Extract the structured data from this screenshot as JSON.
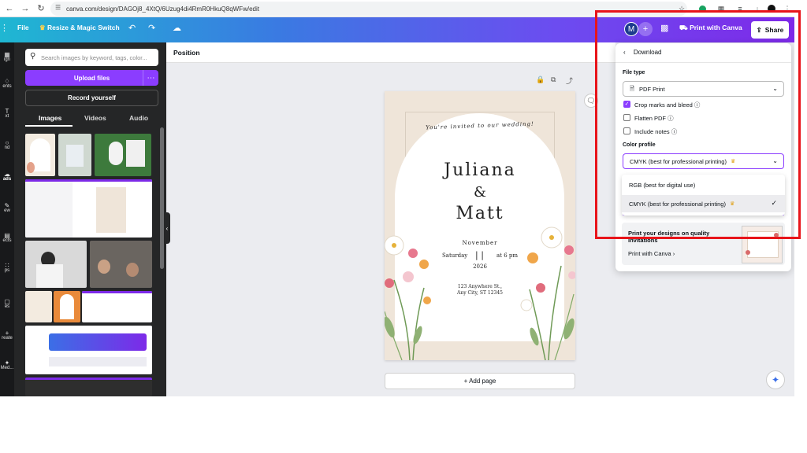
{
  "browser": {
    "url": "canva.com/design/DAGOj8_4XtQ/6Uzug4di4RmR0HkuQ8qWFw/edit"
  },
  "topbar": {
    "file_label": "File",
    "resize_label": "Resize & Magic Switch",
    "avatar_letter": "M",
    "print_label": "Print with Canva",
    "share_label": "Share"
  },
  "rail": {
    "items": [
      "ign",
      "ents",
      "xt",
      "nd",
      "ads",
      "ew",
      "ects",
      "ps",
      "es",
      "reate",
      "Med..."
    ]
  },
  "panel": {
    "search_placeholder": "Search images by keyword, tags, color...",
    "upload_label": "Upload files",
    "record_label": "Record yourself",
    "tabs": [
      "Images",
      "Videos",
      "Audio"
    ]
  },
  "editor": {
    "position_label": "Position",
    "add_page_label": "+ Add page"
  },
  "invitation": {
    "tagline": "You're invited to our wedding!",
    "name1": "Juliana",
    "amp": "&",
    "name2": "Matt",
    "month": "November",
    "day": "Saturday",
    "date_num": "| |",
    "time": "at 6 pm",
    "year": "2026",
    "address1": "123 Anywhere St.,",
    "address2": "Any City, ST 12345"
  },
  "download": {
    "title": "Download",
    "file_type_label": "File type",
    "file_type_value": "PDF Print",
    "options": [
      {
        "label": "Crop marks and bleed",
        "checked": true
      },
      {
        "label": "Flatten PDF",
        "checked": false
      },
      {
        "label": "Include notes",
        "checked": false
      }
    ],
    "color_profile_label": "Color profile",
    "color_profile_value": "CMYK (best for professional printing)",
    "list": [
      {
        "label": "RGB (best for digital use)",
        "selected": false
      },
      {
        "label": "CMYK (best for professional printing)",
        "selected": true
      }
    ],
    "promo_title": "Print your designs on quality invitations",
    "promo_link": "Print with Canva"
  },
  "colors": {
    "accent": "#8b3dff",
    "annotation": "#e8141a"
  }
}
